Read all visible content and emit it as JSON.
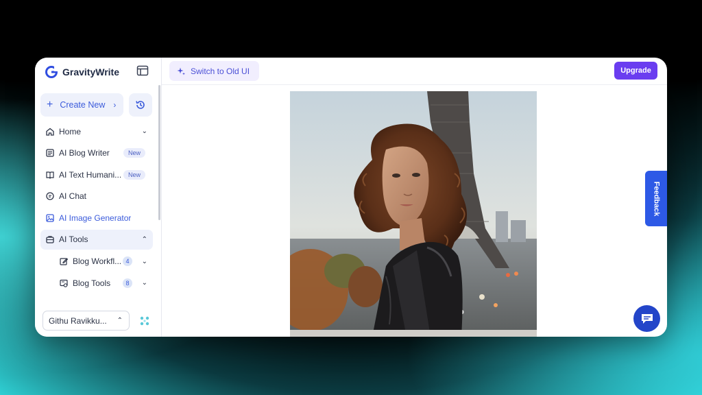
{
  "brand": {
    "name": "GravityWrite"
  },
  "sidebar": {
    "create_label": "Create New",
    "items": [
      {
        "label": "Home",
        "icon": "home-icon"
      },
      {
        "label": "AI Blog Writer",
        "icon": "document-icon",
        "badge": "New"
      },
      {
        "label": "AI Text Humani...",
        "icon": "book-icon",
        "badge": "New"
      },
      {
        "label": "AI Chat",
        "icon": "chat-icon"
      },
      {
        "label": "AI Image Generator",
        "icon": "image-icon"
      },
      {
        "label": "AI Tools",
        "icon": "briefcase-icon"
      },
      {
        "label": "Blog Workfl...",
        "icon": "edit-icon",
        "count": "4"
      },
      {
        "label": "Blog Tools",
        "icon": "tools-icon",
        "count": "8"
      }
    ],
    "user": "Githu Ravikku..."
  },
  "topbar": {
    "switch_label": "Switch to Old UI",
    "upgrade_label": "Upgrade"
  },
  "feedback_label": "Feedback",
  "colors": {
    "accent": "#3b5bdb",
    "upgrade": "#6a3df0",
    "feedback": "#2d59e6"
  }
}
